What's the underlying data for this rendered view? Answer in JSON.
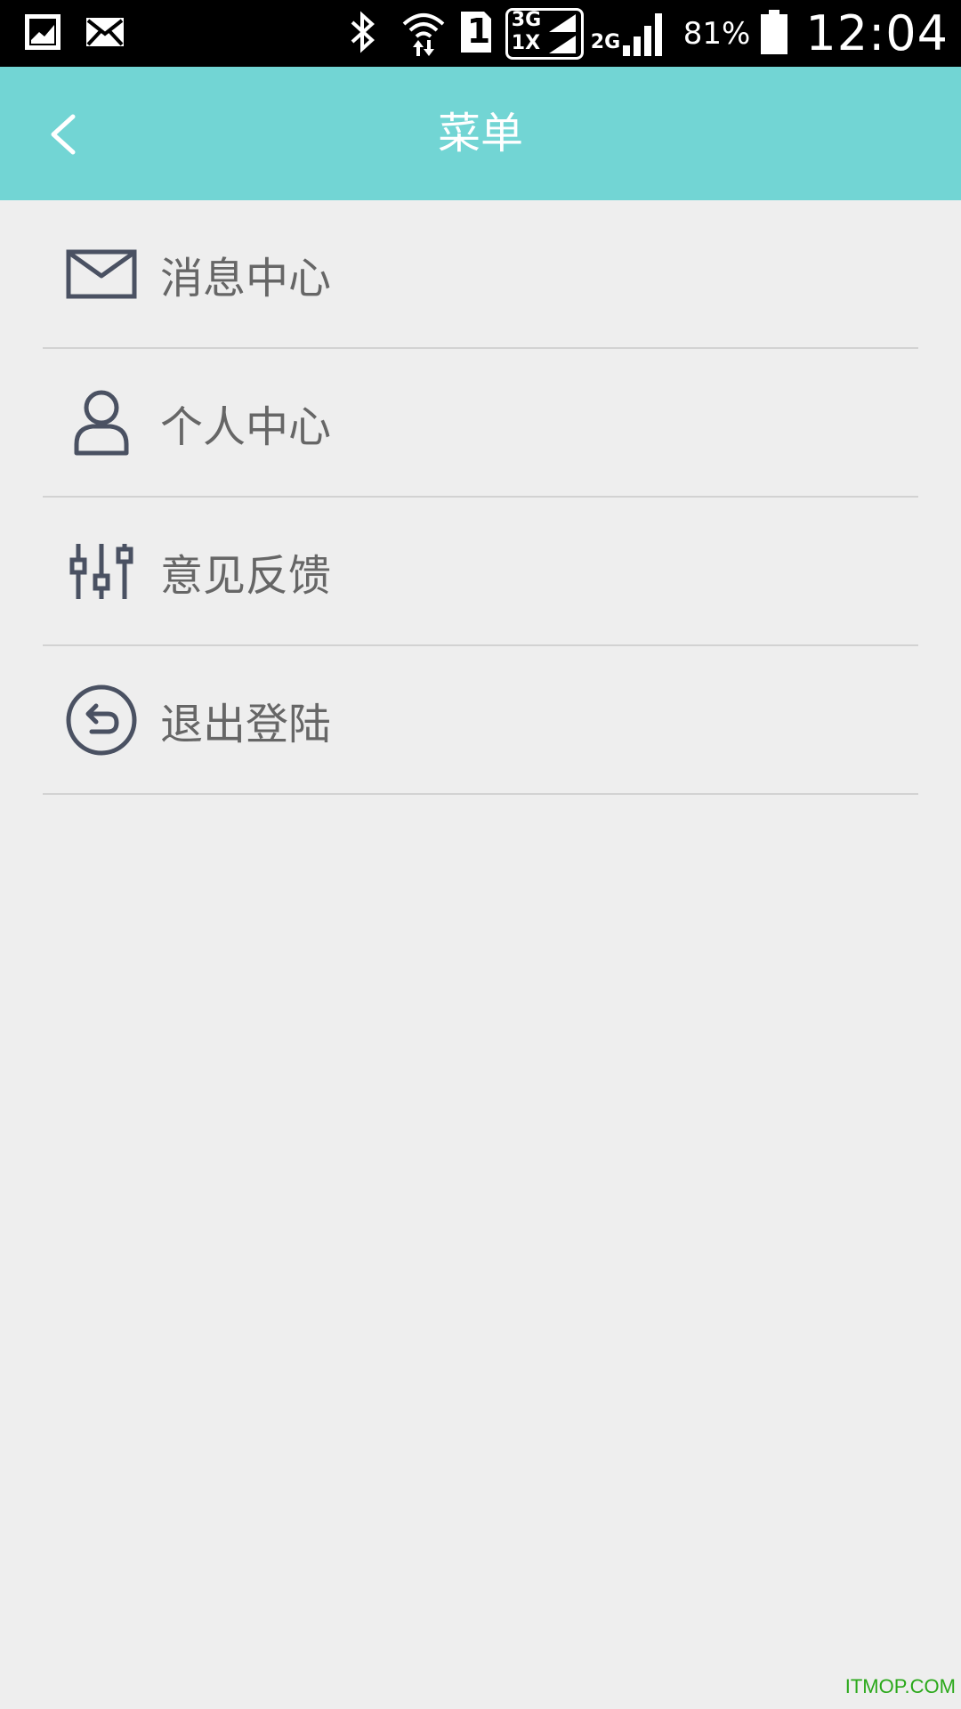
{
  "status_bar": {
    "battery_percent": "81%",
    "time": "12:04",
    "network_3g": "3G",
    "network_1x": "1X",
    "network_2g": "2G",
    "sim_slot": "1",
    "icons": [
      "image-icon",
      "mail-icon",
      "bluetooth-icon",
      "wifi-icon",
      "sim-icon",
      "signal-icon",
      "battery-icon"
    ]
  },
  "header": {
    "title": "菜单",
    "background_color": "#72d5d4",
    "back_icon": "chevron-left-icon"
  },
  "menu": {
    "items": [
      {
        "label": "消息中心",
        "icon": "mail-icon"
      },
      {
        "label": "个人中心",
        "icon": "user-icon"
      },
      {
        "label": "意见反馈",
        "icon": "sliders-icon"
      },
      {
        "label": "退出登陆",
        "icon": "logout-icon"
      }
    ]
  },
  "watermark": "ITMOP.COM",
  "colors": {
    "icon": "#4a5162",
    "label": "#666666",
    "divider": "#d2d2d2",
    "page_background": "#eeeeee"
  }
}
